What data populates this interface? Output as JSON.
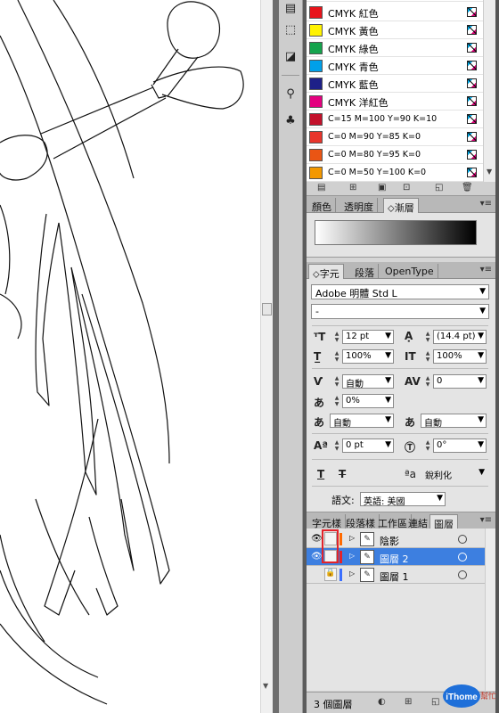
{
  "swatches": {
    "items": [
      {
        "name": "CMYK 紅色",
        "color": "#e8141b"
      },
      {
        "name": "CMYK 黃色",
        "color": "#fff200"
      },
      {
        "name": "CMYK 綠色",
        "color": "#14a44d"
      },
      {
        "name": "CMYK 青色",
        "color": "#00a0e9"
      },
      {
        "name": "CMYK 藍色",
        "color": "#1d2088"
      },
      {
        "name": "CMYK 洋紅色",
        "color": "#e4007f"
      },
      {
        "name": "C=15 M=100 Y=90 K=10",
        "color": "#c3112b"
      },
      {
        "name": "C=0 M=90 Y=85 K=0",
        "color": "#e8352c"
      },
      {
        "name": "C=0 M=80 Y=95 K=0",
        "color": "#ea5514"
      },
      {
        "name": "C=0 M=50 Y=100 K=0",
        "color": "#f39800"
      }
    ]
  },
  "gradient_panel": {
    "tabs": [
      "顏色",
      "透明度",
      "漸層"
    ],
    "active_tab": "漸層"
  },
  "character_panel": {
    "tabs": [
      "字元",
      "段落",
      "OpenType"
    ],
    "font_family": "Adobe 明體 Std L",
    "font_style": "-",
    "font_size": "12 pt",
    "leading": "(14.4 pt)",
    "vertical_scale": "100%",
    "horizontal_scale": "100%",
    "kerning": "自動",
    "tracking": "0",
    "tsume": "0%",
    "aki_before": "自動",
    "aki_after": "自動",
    "baseline_shift": "0 pt",
    "rotation": "0°",
    "anti_alias": "銳利化",
    "language_label": "語文:",
    "language": "英語: 美國"
  },
  "layers_panel": {
    "tabs": [
      "字元樣",
      "段落樣",
      "工作區",
      "連結",
      "圖層"
    ],
    "layers": [
      {
        "name": "陰影",
        "selected": false,
        "tag_color": "#ff6a00"
      },
      {
        "name": "圖層 2",
        "selected": true,
        "tag_color": "#e3232a"
      },
      {
        "name": "圖層 1",
        "selected": false,
        "tag_color": "#3b6fff"
      }
    ],
    "count_label": "3 個圖層"
  },
  "watermark": {
    "logo_text": "iThome",
    "sub_text": "幫忙"
  }
}
